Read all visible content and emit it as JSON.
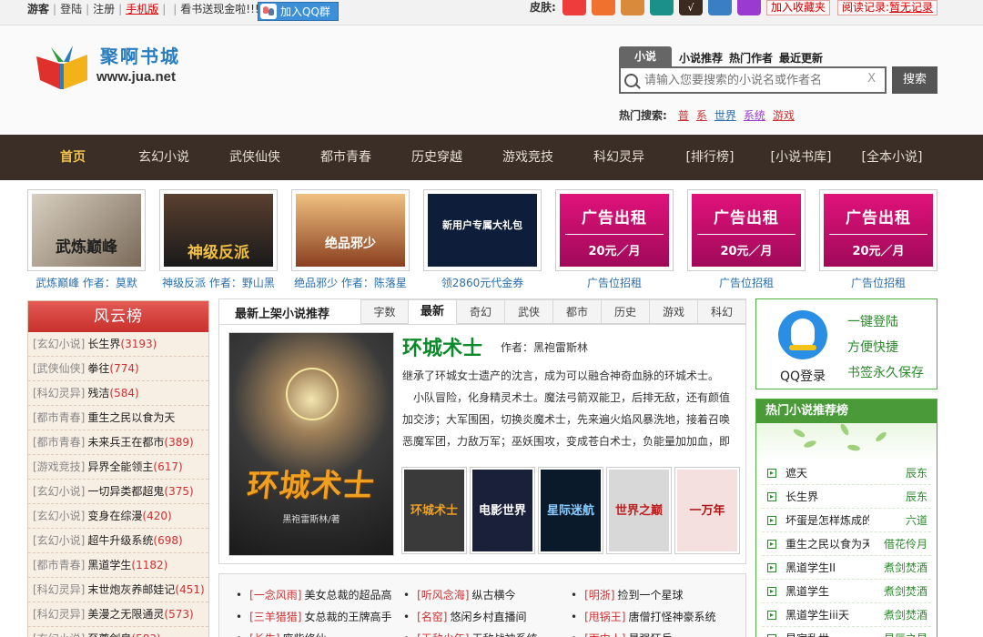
{
  "topbar": {
    "guest": "游客",
    "login": "登陆",
    "register": "注册",
    "mobile": "手机版",
    "promo": "看书送现金啦!!!",
    "qq_group": "加入QQ群",
    "skin_label": "皮肤:",
    "skins": [
      "#ee3b3b",
      "#f0702e",
      "#d98a3a",
      "#1a9088",
      "#3a2a20",
      "#3a7fc4",
      "#9a3ad0"
    ],
    "favorite": "加入收藏夹",
    "reading_record_label": "阅读记录:",
    "reading_record_value": "暂无记录"
  },
  "header": {
    "logo_cn": "聚啊书城",
    "logo_en": "www.jua.net",
    "search_tab_active": "小说",
    "search_tabs": [
      "小说推荐",
      "热门作者",
      "最近更新"
    ],
    "search_placeholder": "请输入您要搜索的小说名或作者名",
    "search_clear": "X",
    "search_button": "搜索",
    "hot_search_label": "热门搜索:",
    "hot_keywords": [
      "普",
      "系",
      "世界",
      "系统",
      "游戏"
    ]
  },
  "nav": {
    "items": [
      "首页",
      "玄幻小说",
      "武侠仙侠",
      "都市青春",
      "历史穿越",
      "游戏竞技",
      "科幻灵异",
      "[排行榜]",
      "[小说书库]",
      "[全本小说]"
    ]
  },
  "banners": [
    {
      "art": "武炼巅峰",
      "caption": "武炼巅峰 作者：莫默"
    },
    {
      "art": "神级反派",
      "caption": "神级反派 作者：野山黑"
    },
    {
      "art": "绝品邪少",
      "caption": "绝品邪少 作者：陈落星"
    },
    {
      "art": "新用户专属大礼包",
      "caption": "领2860元代金券"
    },
    {
      "art": "广告出租",
      "art2": "20元／月",
      "caption": "广告位招租"
    },
    {
      "art": "广告出租",
      "art2": "20元／月",
      "caption": "广告位招租"
    },
    {
      "art": "广告出租",
      "art2": "20元／月",
      "caption": "广告位招租"
    }
  ],
  "ranklist": {
    "title": "风云榜",
    "items": [
      {
        "cat": "[玄幻小说]",
        "title": "长生界",
        "count": "(3193)"
      },
      {
        "cat": "[武侠仙侠]",
        "title": "拳往",
        "count": "(774)"
      },
      {
        "cat": "[科幻灵异]",
        "title": "残洁",
        "count": "(584)"
      },
      {
        "cat": "[都市青春]",
        "title": "重生之民以食为天",
        "count": ""
      },
      {
        "cat": "[都市青春]",
        "title": "未来兵王在都市",
        "count": "(389)"
      },
      {
        "cat": "[游戏竞技]",
        "title": "异界全能领主",
        "count": "(617)"
      },
      {
        "cat": "[玄幻小说]",
        "title": "一切异类都超鬼",
        "count": "(375)"
      },
      {
        "cat": "[玄幻小说]",
        "title": "变身在综漫",
        "count": "(420)"
      },
      {
        "cat": "[玄幻小说]",
        "title": "超牛升级系统",
        "count": "(698)"
      },
      {
        "cat": "[都市青春]",
        "title": "黑道学生",
        "count": "(1182)"
      },
      {
        "cat": "[科幻灵异]",
        "title": "末世炮灰养邮娃记",
        "count": "(451)"
      },
      {
        "cat": "[科幻灵异]",
        "title": "美漫之无限通灵",
        "count": "(573)"
      },
      {
        "cat": "[玄幻小说]",
        "title": "至尊剑皇",
        "count": "(583)"
      }
    ]
  },
  "center": {
    "title": "最新上架小说推荐",
    "tabs": [
      "字数",
      "最新",
      "奇幻",
      "武侠",
      "都市",
      "历史",
      "游戏",
      "科幻"
    ],
    "active_tab": 1,
    "cover_title": "环城术士",
    "cover_author": "黑袍雷斯林/著",
    "book_title": "环城术士",
    "book_author": "作者：黑袍雷斯林",
    "desc_lines": [
      "继承了环城女士遗产的沈言，成为可以融合神奇血脉的环城术士。",
      "　小队冒险，化身精灵术士。魔法弓箭双能卫，后排无敌，还有颜值",
      "加交涉；大军围困，切换炎魔术士，先来遍火焰风暴洗地，接着召唤",
      "恶魔军团，力敌万军；巫妖围攻，变成苍白术士，负能量加加血，即"
    ],
    "thumbs": [
      {
        "text": "环城术士",
        "bg": "#3a3a3a",
        "fg": "#f0a020"
      },
      {
        "text": "电影世界",
        "bg": "#1a1f3a",
        "fg": "#ffffff"
      },
      {
        "text": "星际迷航",
        "bg": "#0a1a2a",
        "fg": "#88ccff"
      },
      {
        "text": "世界之巅",
        "bg": "#d8d8d8",
        "fg": "#c02020"
      },
      {
        "text": "一万年",
        "bg": "#f5e0e0",
        "fg": "#b01818"
      }
    ]
  },
  "qq_login": {
    "label": "QQ登录",
    "features": [
      "一键登陆",
      "方便快捷",
      "书签永久保存"
    ]
  },
  "hot_rec": {
    "title": "热门小说推荐榜",
    "items": [
      {
        "name": "遮天",
        "author": "辰东"
      },
      {
        "name": "长生界",
        "author": "辰东"
      },
      {
        "name": "坏蛋是怎样炼成的",
        "author": "六道"
      },
      {
        "name": "重生之民以食为天",
        "author": "借花伶月"
      },
      {
        "name": "黑道学生II",
        "author": "煮剑焚酒"
      },
      {
        "name": "黑道学生",
        "author": "煮剑焚酒"
      },
      {
        "name": "黑道学生iii天",
        "author": "煮剑焚酒"
      },
      {
        "name": "星宿乱世",
        "author": "星辰之星"
      }
    ]
  },
  "bottom_list": [
    {
      "cat": "[一念风雨]",
      "name": "美女总裁的超品高"
    },
    {
      "cat": "[听风念海]",
      "name": "纵古横今"
    },
    {
      "cat": "[明浙]",
      "name": "捡到一个星球"
    },
    {
      "cat": "[三羊猎猎]",
      "name": "女总裁的王牌高手"
    },
    {
      "cat": "[名窑]",
      "name": "悠闲乡村直播间"
    },
    {
      "cat": "[甩锅王]",
      "name": "唐僧打怪神豪系统"
    },
    {
      "cat": "[长生]",
      "name": "废柴修仙"
    },
    {
      "cat": "[无敌少年]",
      "name": "无敌战神系统"
    },
    {
      "cat": "[雨中人]",
      "name": "最强狂兵"
    }
  ]
}
